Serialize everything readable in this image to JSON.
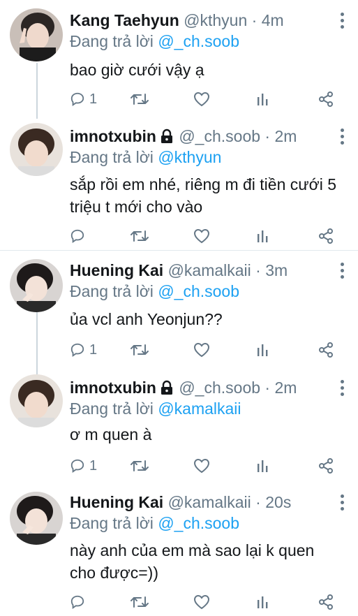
{
  "replying_label": "Đang trả lời",
  "colors": {
    "accent": "#1da1f2",
    "secondary": "#657786",
    "text": "#14171a",
    "divider": "#e1e8ed",
    "thread_line": "#ccd6dd"
  },
  "tweets": [
    {
      "name": "Kang Taehyun",
      "handle": "@kthyun",
      "time": "4m",
      "locked": false,
      "mention": "@_ch.soob",
      "text": "bao giờ cưới vậy ạ",
      "reply_count": "1"
    },
    {
      "name": "imnotxubin",
      "handle": "@_ch.soob",
      "time": "2m",
      "locked": true,
      "mention": "@kthyun",
      "text": "sắp rồi em nhé, riêng m đi tiền cưới 5 triệu t mới cho vào",
      "reply_count": ""
    },
    {
      "name": "Huening Kai",
      "handle": "@kamalkaii",
      "time": "3m",
      "locked": false,
      "mention": "@_ch.soob",
      "text": "ủa vcl anh Yeonjun??",
      "reply_count": "1"
    },
    {
      "name": "imnotxubin",
      "handle": "@_ch.soob",
      "time": "2m",
      "locked": true,
      "mention": "@kamalkaii",
      "text": "ơ m quen à",
      "reply_count": "1"
    },
    {
      "name": "Huening Kai",
      "handle": "@kamalkaii",
      "time": "20s",
      "locked": false,
      "mention": "@_ch.soob",
      "text": "này anh của em mà sao lại k quen cho được=))",
      "reply_count": ""
    }
  ]
}
